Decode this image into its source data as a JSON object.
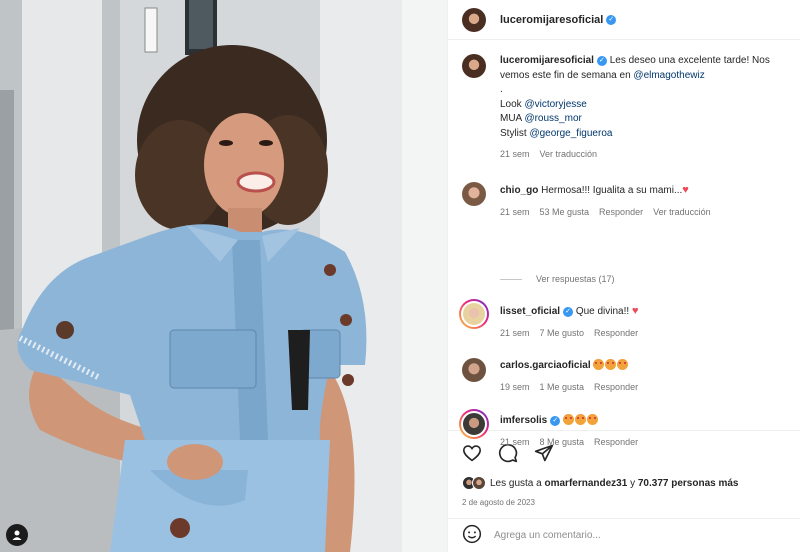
{
  "header": {
    "username": "luceromijaresoficial"
  },
  "caption": {
    "username": "luceromijaresoficial",
    "text_before": "Les deseo una excelente tarde! Nos vemos este fin de semana en ",
    "mention_venue": "@elmagothewiz",
    "dot": ".",
    "look_label": "Look ",
    "look_mention": "@victoryjesse",
    "mua_label": "MUA ",
    "mua_mention": "@rouss_mor",
    "stylist_label": "Stylist ",
    "stylist_mention": "@george_figueroa",
    "time": "21 sem",
    "translate": "Ver traducción"
  },
  "comments": [
    {
      "username": "chio_go",
      "text": "Hermosa!!! Igualita a su mami...",
      "time": "21 sem",
      "likes": "53 Me gusta",
      "reply": "Responder",
      "translate": "Ver traducción",
      "view_replies": "Ver respuestas (17)"
    },
    {
      "username": "lisset_oficial",
      "text": "Que divina!!",
      "time": "21 sem",
      "likes": "7 Me gusto",
      "reply": "Responder"
    },
    {
      "username": "carlos.garciaoficial",
      "time": "19 sem",
      "likes": "1 Me gusta",
      "reply": "Responder"
    },
    {
      "username": "imfersolis",
      "time": "21 sem",
      "likes": "8 Me gusta",
      "reply": "Responder"
    }
  ],
  "likes_summary": {
    "prefix": "Les gusta a ",
    "user": "omarfernandez31",
    "middle": " y ",
    "count": "70.377 personas más"
  },
  "post_date": "2 de agosto de 2023",
  "add_comment": {
    "placeholder": "Agrega un comentario..."
  },
  "colors": {
    "link": "#00376b",
    "verified": "#3897f0",
    "heart": "#ed4956",
    "muted": "#737373"
  }
}
